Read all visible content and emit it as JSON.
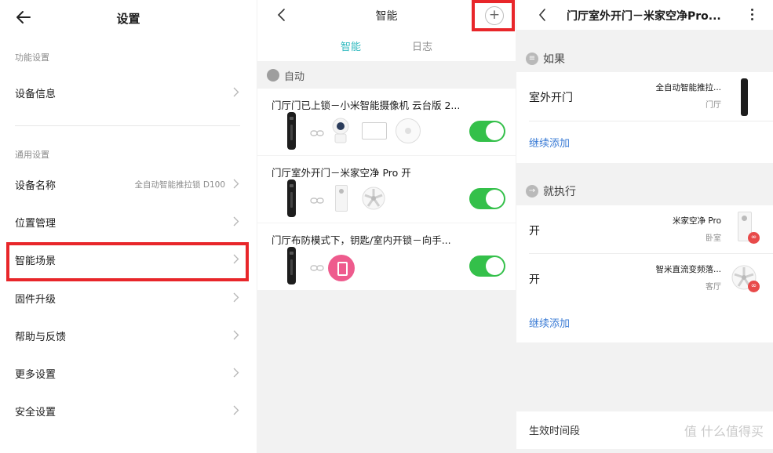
{
  "settings": {
    "title": "设置",
    "section_function": "功能设置",
    "device_info": "设备信息",
    "section_general": "通用设置",
    "device_name_label": "设备名称",
    "device_name_value": "全自动智能推拉锁 D100",
    "location": "位置管理",
    "smart_scene": "智能场景",
    "firmware": "固件升级",
    "help": "帮助与反馈",
    "more": "更多设置",
    "security": "安全设置"
  },
  "smart": {
    "title": "智能",
    "add_symbol": "+",
    "tabs": [
      "智能",
      "日志"
    ],
    "auto_label": "自动",
    "cards": [
      {
        "title": "门厅门已上锁－小米智能摄像机 云台版 2..."
      },
      {
        "title": "门厅室外开门－米家空净 Pro 开"
      },
      {
        "title": "门厅布防模式下，钥匙/室内开锁－向手..."
      }
    ]
  },
  "scene_detail": {
    "title": "门厅室外开门－米家空净Pro...",
    "if_label": "如果",
    "condition": {
      "label": "室外开门",
      "device": "全自动智能推拉...",
      "room": "门厅"
    },
    "add_more": "继续添加",
    "then_label": "就执行",
    "actions": [
      {
        "label": "开",
        "device": "米家空净 Pro",
        "room": "卧室"
      },
      {
        "label": "开",
        "device": "智米直流变频落...",
        "room": "客厅"
      }
    ],
    "add_more_2": "继续添加",
    "time_label": "生效时间段",
    "watermark": "值 什么值得买"
  },
  "colors": {
    "accent": "#32bac0",
    "toggle_on": "#34c04a",
    "highlight": "#e8262a",
    "link": "#3a7bd5"
  }
}
